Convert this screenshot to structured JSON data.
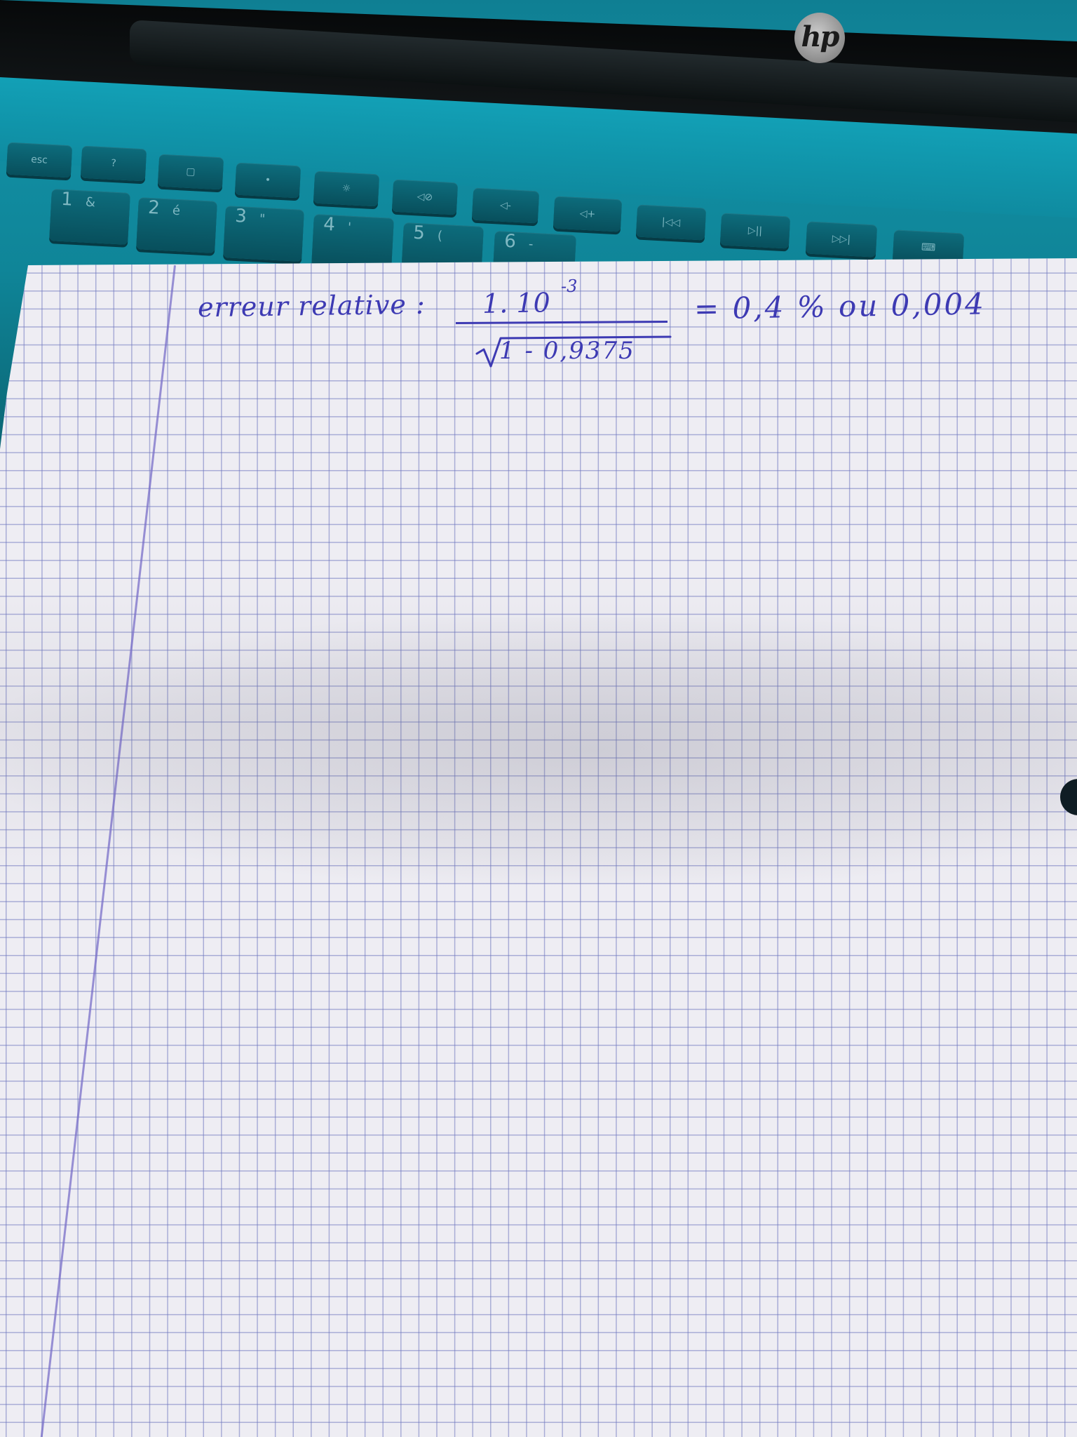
{
  "laptop": {
    "brand": "hp",
    "function_keys": [
      "esc",
      "?",
      "▢",
      "•",
      "☼",
      "◁⊘",
      "◁-",
      "◁+",
      "|◁◁",
      "▷||",
      "▷▷|",
      "⌨"
    ],
    "number_keys": [
      {
        "main": "1",
        "sub": "&"
      },
      {
        "main": "2",
        "sub": "é"
      },
      {
        "main": "3",
        "sub": "\""
      },
      {
        "main": "4",
        "sub": "'"
      },
      {
        "main": "5",
        "sub": "("
      },
      {
        "main": "6",
        "sub": "-"
      }
    ],
    "colors": {
      "body": "#0f8ba0",
      "keys": "#0a5e6d"
    }
  },
  "paper": {
    "colors": {
      "paper": "#eeedf3",
      "grid": "#6e76be",
      "ink": "#3d3ab3"
    },
    "note": {
      "label": "erreur relative :",
      "numerator": "1. 10",
      "exponent": "-3",
      "radicand": "1 - 0,9375",
      "result": "= 0,4 % ou 0,004"
    }
  }
}
